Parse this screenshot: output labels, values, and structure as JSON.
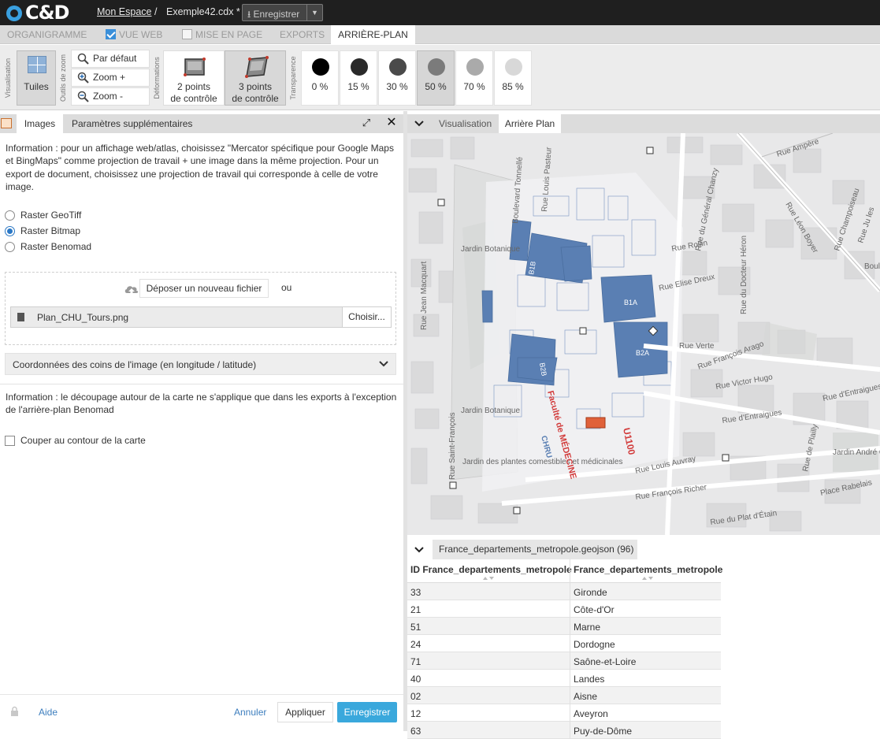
{
  "topbar": {
    "logo": "C&D",
    "breadcrumb_space": "Mon Espace",
    "breadcrumb_separator": "/",
    "filename": "Exemple42.cdx *",
    "save_label": "Enregistrer"
  },
  "tabs": {
    "organigramme": "ORGANIGRAMME",
    "vue_web": "VUE WEB",
    "mise_en_page": "MISE EN PAGE",
    "exports": "EXPORTS",
    "arriere_plan": "ARRIÈRE-PLAN",
    "vue_web_checked": true,
    "mise_en_page_checked": false
  },
  "ribbon": {
    "visualisation_label": "Visualisation",
    "zoom_tools_label": "Outils de zoom",
    "deformations_label": "Déformations",
    "transparence_label": "Transparence",
    "tuiles": "Tuiles",
    "par_defaut": "Par défaut",
    "zoom_plus": "Zoom +",
    "zoom_minus": "Zoom -",
    "two_points_line1": "2 points",
    "two_points_line2": "de contrôle",
    "three_points_line1": "3 points",
    "three_points_line2": "de contrôle",
    "transparency": [
      {
        "label": "0 %",
        "color": "#000000"
      },
      {
        "label": "15 %",
        "color": "#2a2a2a"
      },
      {
        "label": "30 %",
        "color": "#4a4a4a"
      },
      {
        "label": "50 %",
        "color": "#7b7b7b"
      },
      {
        "label": "70 %",
        "color": "#aaaaaa"
      },
      {
        "label": "85 %",
        "color": "#d8d8d8"
      }
    ],
    "transparency_selected": "50 %"
  },
  "left_panel": {
    "tab_images": "Images",
    "tab_params": "Paramètres supplémentaires",
    "info1": "Information : pour un affichage web/atlas, choisissez \"Mercator spécifique pour Google Maps et BingMaps\" comme projection de travail + une image dans la même projection. Pour un export de document, choisissez une projection de travail qui corresponde à celle de votre image.",
    "radio_geotiff": "Raster GeoTiff",
    "radio_bitmap": "Raster Bitmap",
    "radio_benomad": "Raster Benomad",
    "selected_radio": "Raster Bitmap",
    "deposer_button": "Déposer un nouveau fichier",
    "ou": "ou",
    "file_name": "Plan_CHU_Tours.png",
    "choisir_button": "Choisir...",
    "coords_label": "Coordonnées des coins de l'image (en longitude / latitude)",
    "info2": "Information : le découpage autour de la carte ne s'applique que dans les exports à l'exception de l'arrière-plan Benomad",
    "couper_label": "Couper au contour de la carte",
    "couper_checked": false,
    "footer_aide": "Aide",
    "footer_annuler": "Annuler",
    "footer_appliquer": "Appliquer",
    "footer_enregistrer": "Enregistrer"
  },
  "right_panel": {
    "tab_visualisation": "Visualisation",
    "tab_arriere_plan": "Arrière Plan",
    "map_labels": {
      "boulevard_tonnelle": "Boulevard Tonnellé",
      "rue_louis_pasteur": "Rue Louis Pasteur",
      "jardin_botanique_1": "Jardin Botanique",
      "jardin_botanique_2": "Jardin Botanique",
      "rue_jean_macquart": "Rue Jean Macquart",
      "rue_saint_francois": "Rue Saint-François",
      "jardin_plantes": "Jardin des plantes comestibles et médicinales",
      "rue_rollin": "Rue Rollin",
      "rue_elise_dreux": "Rue Elise Dreux",
      "rue_verte": "Rue Verte",
      "rue_francois_arago": "Rue François Arago",
      "rue_victor_hugo": "Rue Victor Hugo",
      "rue_dentraigues_1": "Rue d'Entraigues",
      "rue_dentraigues_2": "Rue d'Entraigues",
      "rue_ampere": "Rue Ampère",
      "rue_general_chanzy": "Rue du Général Chanzy",
      "rue_leon_boyer": "Rue Léon Boyer",
      "rue_docteur_heron": "Rue du Docteur Héron",
      "rue_champoiseau": "Rue Champoiseau",
      "rue_jules": "Rue Ju les",
      "rue_francois_richer": "Rue François Richer",
      "rue_louis_auvray": "Rue Louis Auvray",
      "rue_plat_etain": "Rue du Plat d'Étain",
      "place_rabelais": "Place Rabelais",
      "rue_plailly": "Rue de Plailly",
      "jardin_andre": "Jardin André Chedid",
      "bou": "Boul",
      "faculte": "Faculté de MÉDECINE",
      "u1100": "U1100",
      "b1a": "B1A",
      "b2a": "B2A",
      "b1b": "B1B",
      "b2b": "B2B",
      "chru": "CHRU"
    },
    "dataset_tab": "France_departements_metropole.geojson (96)",
    "table": {
      "columns": [
        "ID France_departements_metropole",
        "France_departements_metropole"
      ],
      "rows": [
        [
          "33",
          "Gironde"
        ],
        [
          "21",
          "Côte-d'Or"
        ],
        [
          "51",
          "Marne"
        ],
        [
          "24",
          "Dordogne"
        ],
        [
          "71",
          "Saône-et-Loire"
        ],
        [
          "40",
          "Landes"
        ],
        [
          "02",
          "Aisne"
        ],
        [
          "12",
          "Aveyron"
        ],
        [
          "63",
          "Puy-de-Dôme"
        ]
      ]
    }
  }
}
